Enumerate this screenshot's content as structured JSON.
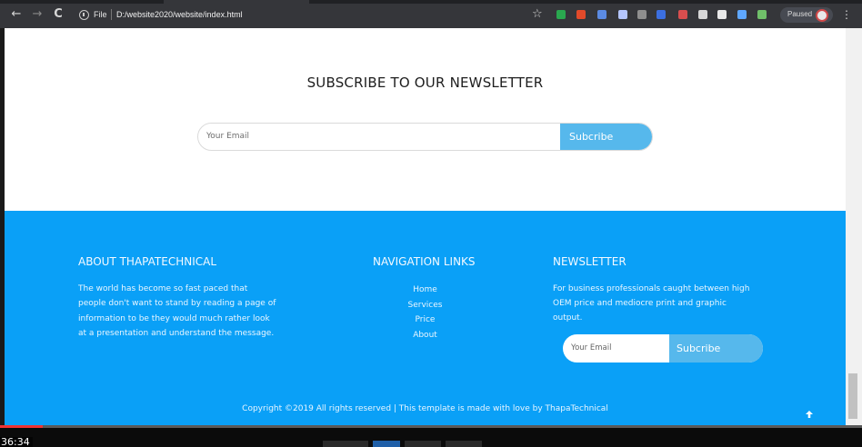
{
  "browser": {
    "scheme_label": "File",
    "url": "D:/website2020/website/index.html",
    "paused_label": "Paused",
    "nav": {
      "back": "←",
      "forward": "→",
      "reload": "C"
    },
    "extensions": [
      "#2aa84f",
      "#e24a2a",
      "#5b8be3",
      "#b4c6ff",
      "#8f8f8f",
      "#3c6fe0",
      "#d94e4e",
      "#d7d7d7",
      "#e9e9e9",
      "#5fa8ff",
      "#70c06a"
    ]
  },
  "subscribe": {
    "title": "SUBSCRIBE TO OUR NEWSLETTER",
    "placeholder": "Your Email",
    "button": "Subcribe"
  },
  "footer": {
    "about": {
      "title": "ABOUT THAPATECHNICAL",
      "lines": [
        "The world has become so fast paced that",
        "people don't want to stand by reading a page of",
        "information to be they would much rather look",
        "at a presentation and understand the message."
      ]
    },
    "nav": {
      "title": "NAVIGATION LINKS",
      "links": [
        "Home",
        "Services",
        "Price",
        "About"
      ]
    },
    "newsletter": {
      "title": "NEWSLETTER",
      "lines": [
        "For business professionals caught between high",
        "OEM price and mediocre print and graphic",
        "output."
      ],
      "placeholder": "Your Email",
      "button": "Subcribe"
    },
    "copyright": "Copyright ©2019 All rights reserved | This template is made with love by ThapaTechnical"
  },
  "video": {
    "timecode": "36:34",
    "progress": 0.05
  },
  "colors": {
    "footer_bg": "#0aa0f7",
    "button_bg": "#56b8ec"
  }
}
